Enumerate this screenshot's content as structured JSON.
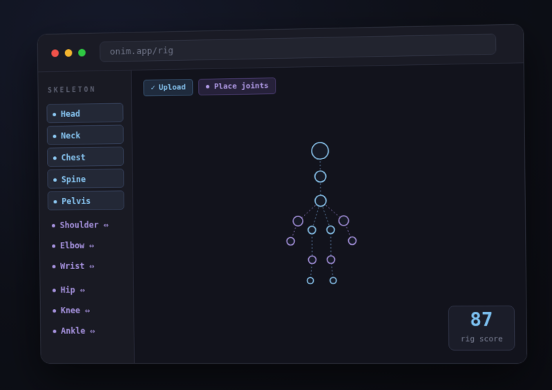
{
  "browser": {
    "url": "onim.app/rig"
  },
  "sidebar": {
    "title": "SKELETON",
    "boxed_items": [
      {
        "label": "Head"
      },
      {
        "label": "Neck"
      },
      {
        "label": "Chest"
      },
      {
        "label": "Spine"
      },
      {
        "label": "Pelvis"
      }
    ],
    "paired_items": [
      {
        "label": "Shoulder ⇔"
      },
      {
        "label": "Elbow ⇔"
      },
      {
        "label": "Wrist ⇔"
      },
      {
        "label": "Hip ⇔"
      },
      {
        "label": "Knee ⇔"
      },
      {
        "label": "Ankle ⇔"
      }
    ]
  },
  "toolbar": {
    "upload_icon": "check-icon",
    "upload_label": "Upload",
    "place_icon": "dot-icon",
    "place_label": "Place joints"
  },
  "rig": {
    "score_value": "87",
    "score_label": "rig score"
  },
  "colors": {
    "core_joint": "#8cc8f2",
    "limb_joint": "#a692de",
    "accent_blue": "#86c3ef",
    "accent_purple": "#b09ae6"
  }
}
